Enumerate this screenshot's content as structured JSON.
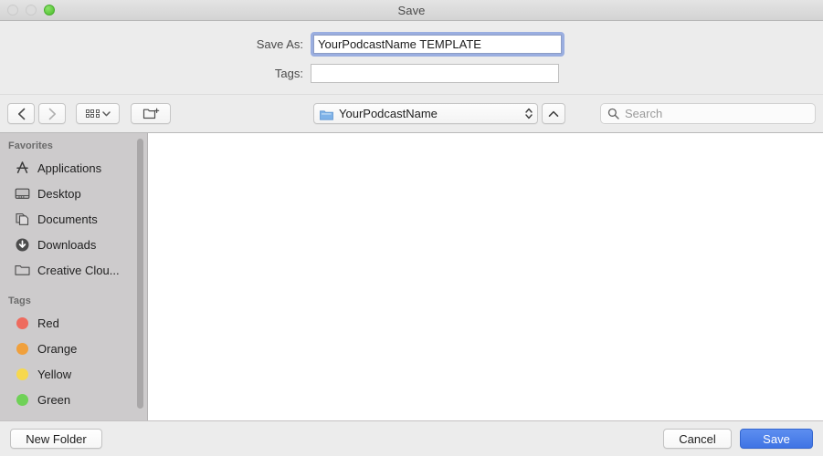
{
  "window": {
    "title": "Save",
    "traffic_lights": [
      {
        "name": "close",
        "state": "disabled"
      },
      {
        "name": "minimize",
        "state": "disabled"
      },
      {
        "name": "zoom",
        "state": "enabled",
        "color": "#5dc83d"
      }
    ]
  },
  "form": {
    "save_as": {
      "label": "Save As:",
      "value": "YourPodcastName TEMPLATE",
      "focused": true
    },
    "tags": {
      "label": "Tags:",
      "value": "",
      "placeholder": ""
    }
  },
  "toolbar": {
    "back_icon": "chevron-left-icon",
    "forward_icon": "chevron-right-icon",
    "view_icon": "grid-view-icon",
    "view_chevron": "chevron-down-icon",
    "new_folder_icon": "new-folder-icon",
    "path": {
      "folder_icon": "blue-folder-icon",
      "label": "YourPodcastName",
      "stepper_icon": "up-down-chevron-icon"
    },
    "up_button_icon": "chevron-up-icon",
    "search": {
      "icon": "search-icon",
      "placeholder": "Search",
      "value": ""
    }
  },
  "sidebar": {
    "sections": [
      {
        "header": "Favorites",
        "items": [
          {
            "label": "Applications",
            "icon": "applications-icon"
          },
          {
            "label": "Desktop",
            "icon": "desktop-icon"
          },
          {
            "label": "Documents",
            "icon": "documents-icon"
          },
          {
            "label": "Downloads",
            "icon": "downloads-icon"
          },
          {
            "label": "Creative Clou...",
            "icon": "folder-icon"
          }
        ]
      },
      {
        "header": "Tags",
        "items": [
          {
            "label": "Red",
            "icon": "tag-dot-icon",
            "color": "#ee6b5e"
          },
          {
            "label": "Orange",
            "icon": "tag-dot-icon",
            "color": "#f0a03c"
          },
          {
            "label": "Yellow",
            "icon": "tag-dot-icon",
            "color": "#f6d84e"
          },
          {
            "label": "Green",
            "icon": "tag-dot-icon",
            "color": "#6fd157"
          }
        ]
      }
    ]
  },
  "footer": {
    "new_folder_label": "New Folder",
    "cancel_label": "Cancel",
    "save_label": "Save",
    "save_accent": "#3f74e4"
  }
}
